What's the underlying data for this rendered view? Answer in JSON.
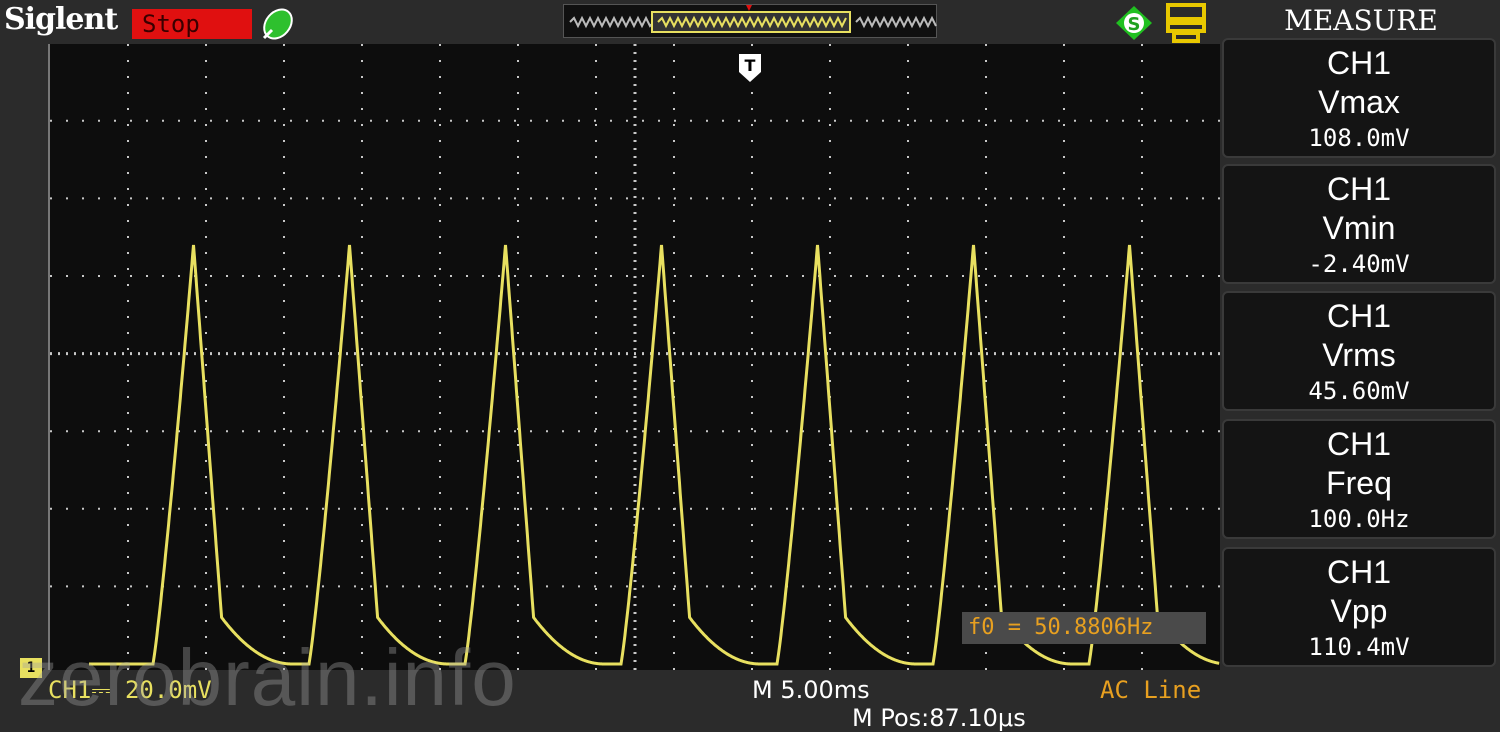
{
  "header": {
    "brand": "Siglent",
    "run_status": "Stop"
  },
  "icons": {
    "probe": "probe-icon",
    "sync": "sync-icon",
    "usb": "usb-icon",
    "trigger": "trigger-marker-icon",
    "channel": "channel-1-marker-icon"
  },
  "colors": {
    "trace": "#e8e060",
    "grid": "#c8c8c8",
    "stop_bg": "#e01010",
    "trigger_text": "#e8a020"
  },
  "measure": {
    "title": "MEASURE",
    "items": [
      {
        "channel": "CH1",
        "name": "Vmax",
        "value": "108.0mV"
      },
      {
        "channel": "CH1",
        "name": "Vmin",
        "value": "-2.40mV"
      },
      {
        "channel": "CH1",
        "name": "Vrms",
        "value": "45.60mV"
      },
      {
        "channel": "CH1",
        "name": "Freq",
        "value": "100.0Hz"
      },
      {
        "channel": "CH1",
        "name": "Vpp",
        "value": "110.4mV"
      }
    ]
  },
  "screen": {
    "trigger_label": "T",
    "channel_marker": "1",
    "freq_readout": "f0 = 50.8806Hz"
  },
  "footer": {
    "ch1_scale": "CH1⎓ 20.0mV",
    "time_base": "M 5.00ms",
    "time_pos": "M Pos:87.10μs",
    "trigger_source": "AC Line"
  },
  "watermark": "zerobrain.info",
  "chart_data": {
    "type": "line",
    "title": "",
    "xlabel": "",
    "ylabel": "",
    "x_unit": "ms",
    "y_unit": "mV",
    "xlim": [
      -35,
      40
    ],
    "ylim": [
      0,
      160
    ],
    "timebase_per_div_ms": 5,
    "volts_per_div_mV": 20,
    "series": [
      {
        "peaks_x_ms": [
          -28.3,
          -18.3,
          -8.3,
          1.7,
          11.7,
          21.7,
          31.7
        ],
        "peak_mV": 108.0,
        "min_mV": -2.4,
        "rise_ms": 2.6,
        "decay_ms": 1.8,
        "tail_ms": 4.5,
        "period_ms": 10.0
      }
    ]
  }
}
